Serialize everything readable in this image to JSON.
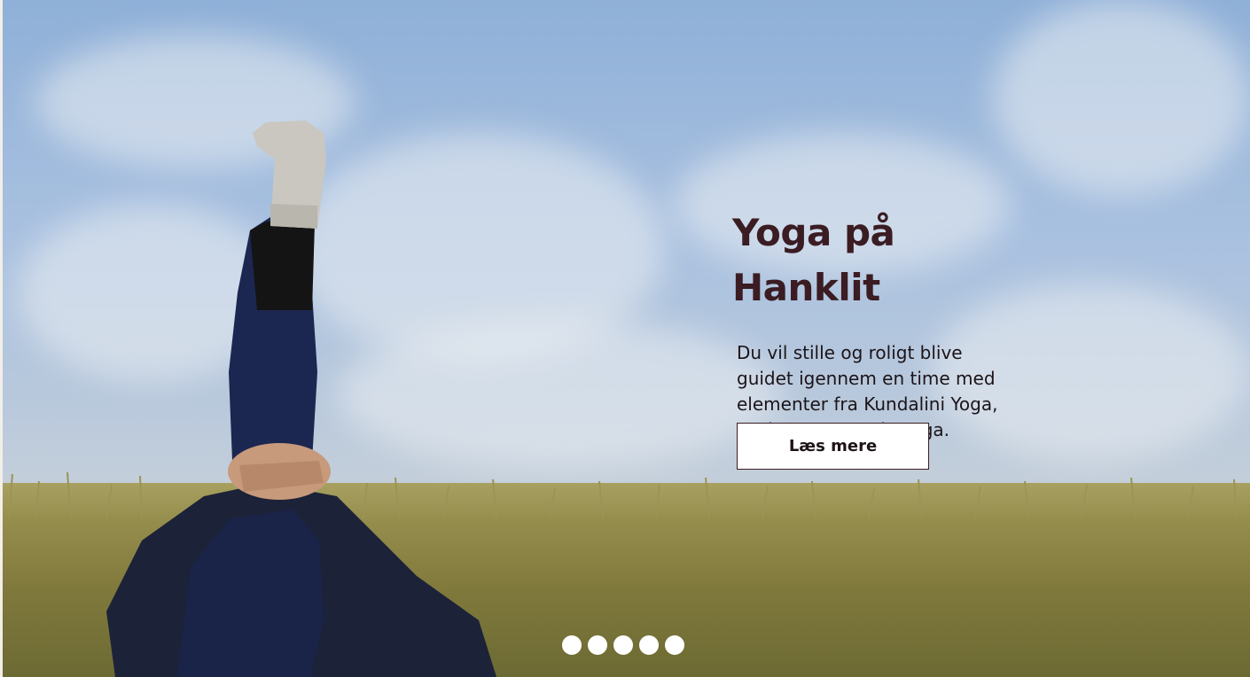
{
  "slide": {
    "title": "Yoga på Hanklit",
    "description": "Du vil stille og roligt blive guidet igennem en time med elementer fra Kundalini Yoga, Hatha Yoga og Yin Yoga.",
    "button_label": "Læs mere"
  },
  "carousel": {
    "dot_count": 5,
    "dot_color": "#ffffff"
  },
  "colors": {
    "title": "#3a1c22",
    "text": "#1c1418"
  }
}
